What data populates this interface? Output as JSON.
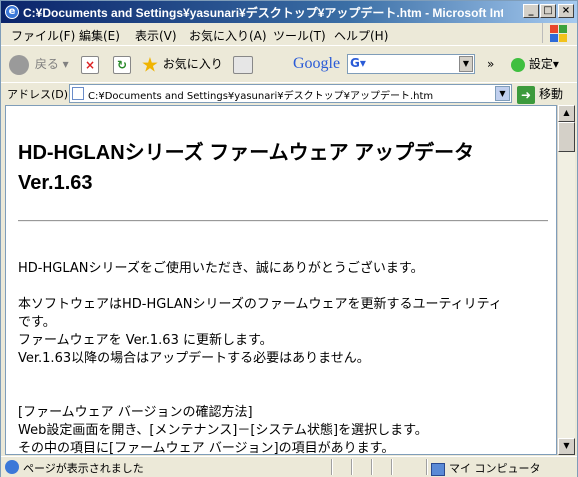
{
  "window": {
    "title": "C:¥Documents and Settings¥yasunari¥デスクトップ¥アップデート.htm - Microsoft Inter...",
    "controls": [
      "_",
      "□",
      "×"
    ]
  },
  "menu": [
    "ファイル(F)",
    "編集(E)",
    "表示(V)",
    "お気に入り(A)",
    "ツール(T)",
    "ヘルプ(H)"
  ],
  "toolbar": {
    "back_label": "戻る",
    "favorites_label": "お気に入り",
    "google_label": "Google",
    "more_label": "»",
    "settings_label": "設定▾"
  },
  "address": {
    "label": "アドレス(D)",
    "url": "C:¥Documents and Settings¥yasunari¥デスクトップ¥アップデート.htm",
    "go_label": "移動"
  },
  "document": {
    "title_line1": "HD-HGLANシリーズ ファームウェア アップデータ",
    "title_line2": "Ver.1.63",
    "p1": "HD-HGLANシリーズをご使用いただき、誠にありがとうございます。",
    "p2_l1": "本ソフトウェアはHD-HGLANシリーズのファームウェアを更新するユーティリティ",
    "p2_l2": "です。",
    "p2_l3": "ファームウェアを Ver.1.63 に更新します。",
    "p2_l4": "Ver.1.63以降の場合はアップデートする必要はありません。",
    "p3_l1": "[ファームウェア バージョンの確認方法]",
    "p3_l2": "Web設定画面を開き、[メンテナンス]－[システム状態]を選択します。",
    "p3_l3": "その中の項目に[ファームウェア バージョン]の項目があります。"
  },
  "status": {
    "text": "ページが表示されました",
    "zone": "マイ コンピュータ"
  },
  "colors": {
    "titlebar": "#0a246a",
    "chrome": "#ece9d8",
    "content_bg": "#ffffff"
  }
}
